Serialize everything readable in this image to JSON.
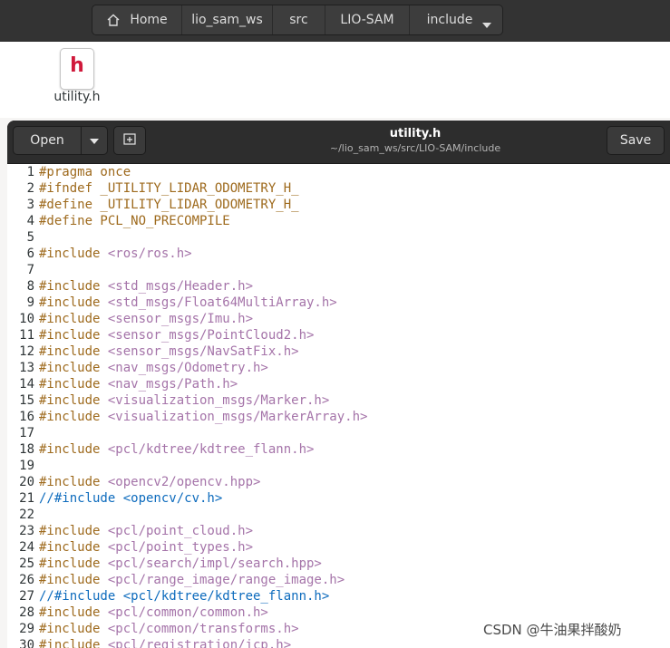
{
  "pathbar": {
    "home": "Home",
    "crumbs": [
      "lio_sam_ws",
      "src",
      "LIO-SAM",
      "include"
    ]
  },
  "desktop": {
    "file_name": "utility.h",
    "file_icon_letter": "h"
  },
  "gedit": {
    "open_label": "Open",
    "save_label": "Save",
    "title": "utility.h",
    "path": "~/lio_sam_ws/src/LIO-SAM/include"
  },
  "code": [
    {
      "n": "1",
      "parts": [
        {
          "c": "kw",
          "t": "#pragma once"
        }
      ]
    },
    {
      "n": "2",
      "parts": [
        {
          "c": "kw",
          "t": "#ifndef _UTILITY_LIDAR_ODOMETRY_H_"
        }
      ]
    },
    {
      "n": "3",
      "parts": [
        {
          "c": "kw",
          "t": "#define _UTILITY_LIDAR_ODOMETRY_H_"
        }
      ]
    },
    {
      "n": "4",
      "parts": [
        {
          "c": "kw",
          "t": "#define PCL_NO_PRECOMPILE"
        }
      ]
    },
    {
      "n": "5",
      "parts": []
    },
    {
      "n": "6",
      "parts": [
        {
          "c": "kw",
          "t": "#include "
        },
        {
          "c": "str",
          "t": "<ros/ros.h>"
        }
      ]
    },
    {
      "n": "7",
      "parts": []
    },
    {
      "n": "8",
      "parts": [
        {
          "c": "kw",
          "t": "#include "
        },
        {
          "c": "str",
          "t": "<std_msgs/Header.h>"
        }
      ]
    },
    {
      "n": "9",
      "parts": [
        {
          "c": "kw",
          "t": "#include "
        },
        {
          "c": "str",
          "t": "<std_msgs/Float64MultiArray.h>"
        }
      ]
    },
    {
      "n": "10",
      "parts": [
        {
          "c": "kw",
          "t": "#include "
        },
        {
          "c": "str",
          "t": "<sensor_msgs/Imu.h>"
        }
      ]
    },
    {
      "n": "11",
      "parts": [
        {
          "c": "kw",
          "t": "#include "
        },
        {
          "c": "str",
          "t": "<sensor_msgs/PointCloud2.h>"
        }
      ]
    },
    {
      "n": "12",
      "parts": [
        {
          "c": "kw",
          "t": "#include "
        },
        {
          "c": "str",
          "t": "<sensor_msgs/NavSatFix.h>"
        }
      ]
    },
    {
      "n": "13",
      "parts": [
        {
          "c": "kw",
          "t": "#include "
        },
        {
          "c": "str",
          "t": "<nav_msgs/Odometry.h>"
        }
      ]
    },
    {
      "n": "14",
      "parts": [
        {
          "c": "kw",
          "t": "#include "
        },
        {
          "c": "str",
          "t": "<nav_msgs/Path.h>"
        }
      ]
    },
    {
      "n": "15",
      "parts": [
        {
          "c": "kw",
          "t": "#include "
        },
        {
          "c": "str",
          "t": "<visualization_msgs/Marker.h>"
        }
      ]
    },
    {
      "n": "16",
      "parts": [
        {
          "c": "kw",
          "t": "#include "
        },
        {
          "c": "str",
          "t": "<visualization_msgs/MarkerArray.h>"
        }
      ]
    },
    {
      "n": "17",
      "parts": []
    },
    {
      "n": "18",
      "parts": [
        {
          "c": "kw",
          "t": "#include "
        },
        {
          "c": "str",
          "t": "<pcl/kdtree/kdtree_flann.h>"
        }
      ]
    },
    {
      "n": "19",
      "parts": []
    },
    {
      "n": "20",
      "parts": [
        {
          "c": "kw",
          "t": "#include "
        },
        {
          "c": "str",
          "t": "<opencv2/opencv.hpp>"
        }
      ]
    },
    {
      "n": "21",
      "parts": [
        {
          "c": "cm",
          "t": "//#include <opencv/cv.h>"
        }
      ]
    },
    {
      "n": "22",
      "parts": []
    },
    {
      "n": "23",
      "parts": [
        {
          "c": "kw",
          "t": "#include "
        },
        {
          "c": "str",
          "t": "<pcl/point_cloud.h>"
        }
      ]
    },
    {
      "n": "24",
      "parts": [
        {
          "c": "kw",
          "t": "#include "
        },
        {
          "c": "str",
          "t": "<pcl/point_types.h>"
        }
      ]
    },
    {
      "n": "25",
      "parts": [
        {
          "c": "kw",
          "t": "#include "
        },
        {
          "c": "str",
          "t": "<pcl/search/impl/search.hpp>"
        }
      ]
    },
    {
      "n": "26",
      "parts": [
        {
          "c": "kw",
          "t": "#include "
        },
        {
          "c": "str",
          "t": "<pcl/range_image/range_image.h>"
        }
      ]
    },
    {
      "n": "27",
      "parts": [
        {
          "c": "cm",
          "t": "//#include <pcl/kdtree/kdtree_flann.h>"
        }
      ]
    },
    {
      "n": "28",
      "parts": [
        {
          "c": "kw",
          "t": "#include "
        },
        {
          "c": "str",
          "t": "<pcl/common/common.h>"
        }
      ]
    },
    {
      "n": "29",
      "parts": [
        {
          "c": "kw",
          "t": "#include "
        },
        {
          "c": "str",
          "t": "<pcl/common/transforms.h>"
        }
      ]
    },
    {
      "n": "30",
      "parts": [
        {
          "c": "kw",
          "t": "#include "
        },
        {
          "c": "str",
          "t": "<pcl/registration/icp.h>"
        }
      ]
    }
  ],
  "watermark": "CSDN @牛油果拌酸奶"
}
